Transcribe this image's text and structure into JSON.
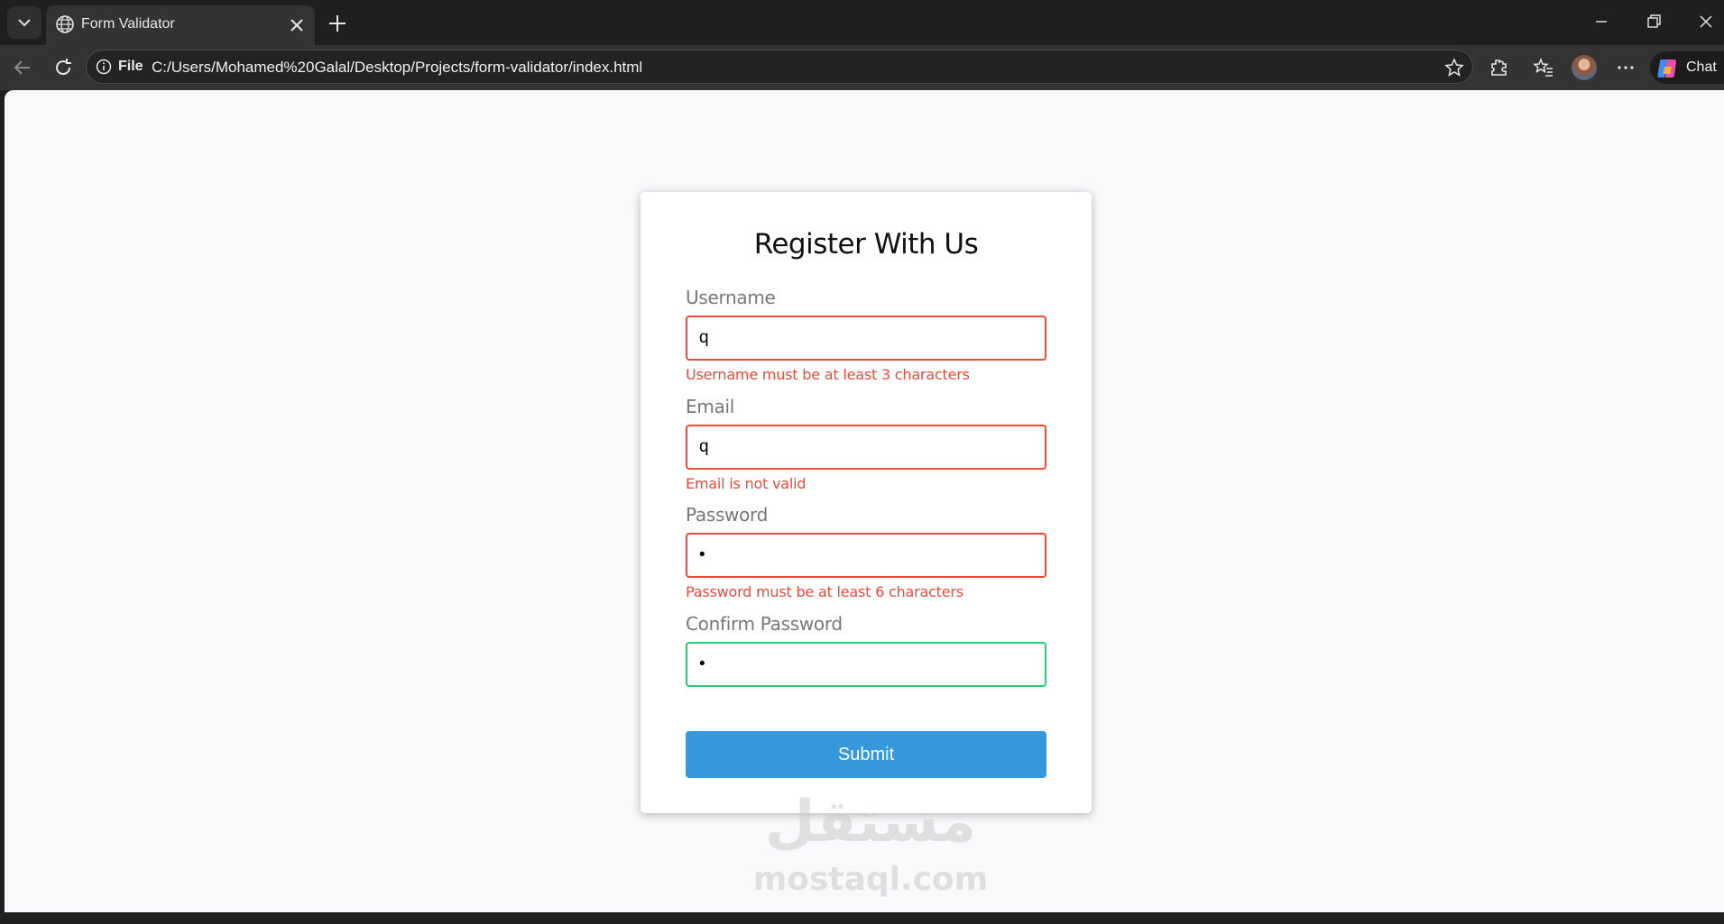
{
  "browser": {
    "tab_title": "Form Validator",
    "address_scheme": "File",
    "address_url": "C:/Users/Mohamed%20Galal/Desktop/Projects/form-validator/index.html",
    "chat_label": "Chat"
  },
  "form": {
    "heading": "Register With Us",
    "fields": [
      {
        "label": "Username",
        "value": "q",
        "error": "Username must be at least 3 characters",
        "status": "error"
      },
      {
        "label": "Email",
        "value": "q",
        "error": "Email is not valid",
        "status": "error"
      },
      {
        "label": "Password",
        "value": "•",
        "error": "Password must be at least 6 characters",
        "status": "error"
      },
      {
        "label": "Confirm Password",
        "value": "•",
        "error": "",
        "status": "success"
      }
    ],
    "submit_label": "Submit"
  },
  "watermark": {
    "arabic": "مستقل",
    "latin": "mostaql.com"
  },
  "colors": {
    "error": "#e74c3c",
    "success": "#2ecc71",
    "button": "#3498db"
  }
}
